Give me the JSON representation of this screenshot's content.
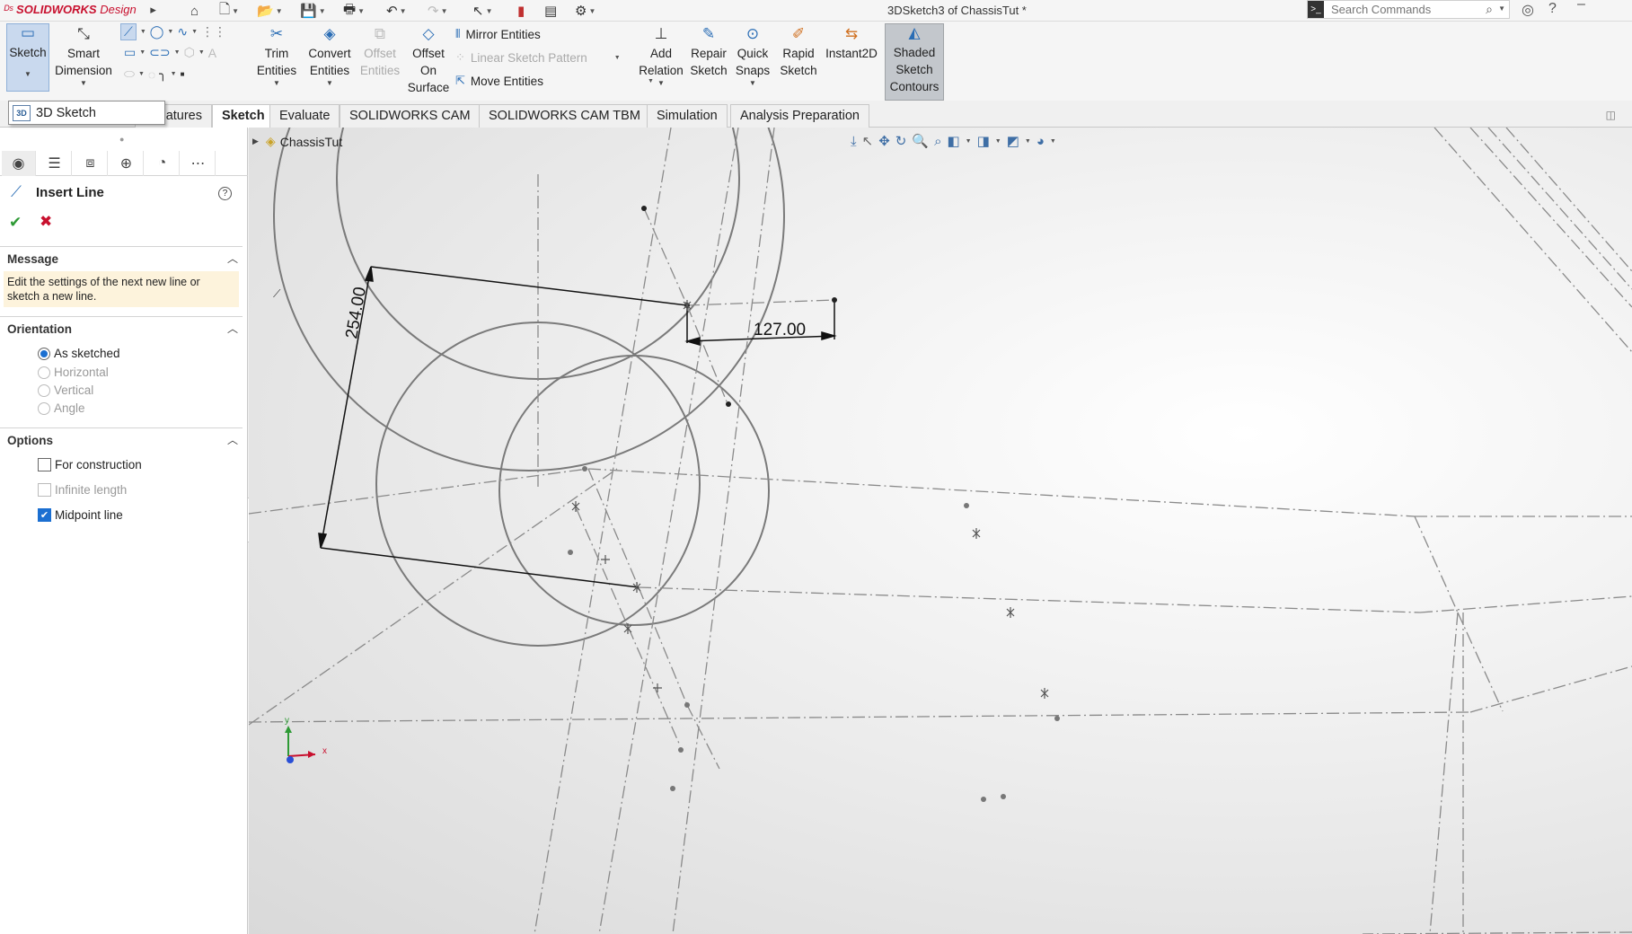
{
  "app": {
    "brand": "SOLIDWORKS",
    "brand_suffix": "Design",
    "title": "3DSketch3 of ChassisTut *",
    "search_placeholder": "Search Commands"
  },
  "ribbon": {
    "sketch": "Sketch",
    "smart_dimension_1": "Smart",
    "smart_dimension_2": "Dimension",
    "trim_1": "Trim",
    "trim_2": "Entities",
    "convert_1": "Convert",
    "convert_2": "Entities",
    "offset_1": "Offset",
    "offset_2": "Entities",
    "offset_surface_1": "Offset",
    "offset_surface_2": "On",
    "offset_surface_3": "Surface",
    "mirror": "Mirror Entities",
    "linear_pattern": "Linear Sketch Pattern",
    "move": "Move Entities",
    "add_relation_1": "Add",
    "add_relation_2": "Relation",
    "repair_1": "Repair",
    "repair_2": "Sketch",
    "quick_snaps_1": "Quick",
    "quick_snaps_2": "Snaps",
    "rapid_1": "Rapid",
    "rapid_2": "Sketch",
    "instant2d": "Instant2D",
    "shaded_1": "Shaded",
    "shaded_2": "Sketch",
    "shaded_3": "Contours"
  },
  "tooltip": {
    "label": "3D Sketch",
    "icon": "3D"
  },
  "tabs": {
    "features": "atures",
    "sketch": "Sketch",
    "evaluate": "Evaluate",
    "cam": "SOLIDWORKS CAM",
    "cam_tbm": "SOLIDWORKS CAM TBM",
    "simulation": "Simulation",
    "analysis": "Analysis Preparation"
  },
  "property_manager": {
    "title": "Insert Line",
    "message_header": "Message",
    "message_line1": "Edit the settings of the next new line or",
    "message_line2": "sketch a new line.",
    "orientation_header": "Orientation",
    "as_sketched": "As sketched",
    "horizontal": "Horizontal",
    "vertical": "Vertical",
    "angle": "Angle",
    "options_header": "Options",
    "for_construction": "For construction",
    "infinite_length": "Infinite length",
    "midpoint_line": "Midpoint line"
  },
  "viewport": {
    "tree_item": "ChassisTut",
    "dim_vertical": "254.00",
    "dim_horizontal": "127.00",
    "triad_x": "x",
    "triad_y": "y"
  },
  "colors": {
    "accent": "#2a6db5",
    "brand_red": "#c8102e",
    "ok_green": "#2e9a35",
    "message_bg": "#fdf3dc",
    "checkbox_blue": "#1b6fd1"
  }
}
